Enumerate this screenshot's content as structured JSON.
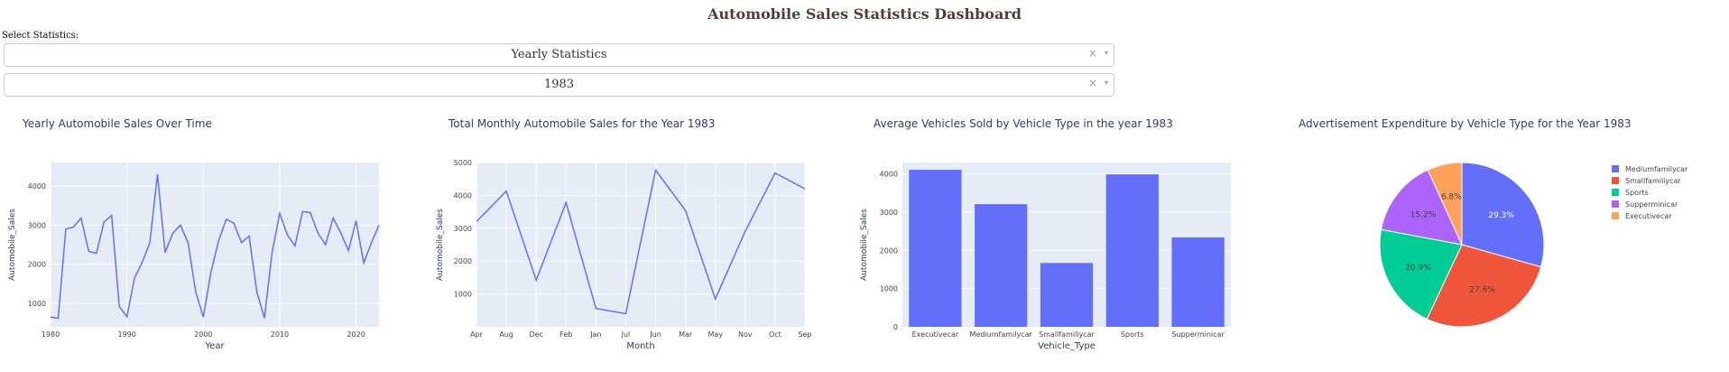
{
  "page": {
    "title": "Automobile Sales Statistics Dashboard",
    "select_label": "Select Statistics:"
  },
  "dropdowns": [
    {
      "value": "Yearly Statistics",
      "clear": "×",
      "caret": "▾"
    },
    {
      "value": "1983",
      "clear": "×",
      "caret": "▾"
    }
  ],
  "colors": {
    "accent": "#636efa",
    "plot_bg": "#e5ecf6",
    "title": "#503d36",
    "pie": [
      "#636efa",
      "#ef553b",
      "#00cc96",
      "#ab63fa",
      "#ffa15a"
    ]
  },
  "chart_data": [
    {
      "type": "line",
      "title": "Yearly Automobile Sales Over Time",
      "xlabel": "Year",
      "ylabel": "Automobile_Sales",
      "xlim": [
        1980,
        2023
      ],
      "ylim": [
        400,
        4600
      ],
      "xticks": [
        1980,
        1990,
        2000,
        2010,
        2020
      ],
      "yticks": [
        1000,
        2000,
        3000,
        4000
      ],
      "x": [
        1980,
        1981,
        1982,
        1983,
        1984,
        1985,
        1986,
        1987,
        1988,
        1989,
        1990,
        1991,
        1992,
        1993,
        1994,
        1995,
        1996,
        1997,
        1998,
        1999,
        2000,
        2001,
        2002,
        2003,
        2004,
        2005,
        2006,
        2007,
        2008,
        2009,
        2010,
        2011,
        2012,
        2013,
        2014,
        2015,
        2016,
        2017,
        2018,
        2019,
        2020,
        2021,
        2022,
        2023
      ],
      "y": [
        650,
        620,
        2900,
        2950,
        3180,
        2330,
        2280,
        3080,
        3250,
        920,
        660,
        1650,
        2050,
        2550,
        4300,
        2300,
        2790,
        3000,
        2550,
        1300,
        650,
        1800,
        2600,
        3150,
        3050,
        2550,
        2720,
        1300,
        620,
        2300,
        3300,
        2750,
        2470,
        3350,
        3320,
        2800,
        2500,
        3180,
        2800,
        2350,
        3110,
        2030,
        2550,
        3000
      ]
    },
    {
      "type": "line",
      "title": "Total Monthly Automobile Sales for the Year 1983",
      "xlabel": "Month",
      "ylabel": "Automobile_Sales",
      "ylim": [
        0,
        5000
      ],
      "yticks": [
        1000,
        2000,
        3000,
        4000,
        5000
      ],
      "categories": [
        "Apr",
        "Aug",
        "Dec",
        "Feb",
        "Jan",
        "Jul",
        "Jun",
        "Mar",
        "May",
        "Nov",
        "Oct",
        "Sep"
      ],
      "values": [
        3200,
        4130,
        1420,
        3780,
        560,
        400,
        4770,
        3540,
        850,
        2910,
        4680,
        4200
      ]
    },
    {
      "type": "bar",
      "title": "Average Vehicles Sold by Vehicle Type in the year 1983",
      "xlabel": "Vehicle_Type",
      "ylabel": "Automobile_Sales",
      "ylim": [
        0,
        4300
      ],
      "yticks": [
        0,
        1000,
        2000,
        3000,
        4000
      ],
      "categories": [
        "Executivecar",
        "Mediumfamilycar",
        "Smallfamiliycar",
        "Sports",
        "Supperminicar"
      ],
      "values": [
        4110,
        3210,
        1670,
        3990,
        2340
      ]
    },
    {
      "type": "pie",
      "title": "Advertisement Expenditure by Vehicle Type for the Year 1983",
      "labels": [
        "Mediumfamilycar",
        "Smallfamiliycar",
        "Sports",
        "Supperminicar",
        "Executivecar"
      ],
      "values": [
        29.3,
        27.6,
        20.9,
        15.2,
        6.8
      ],
      "value_labels": [
        "29.3%",
        "27.6%",
        "20.9%",
        "15.2%",
        "6.8%"
      ],
      "legend": "right"
    }
  ]
}
